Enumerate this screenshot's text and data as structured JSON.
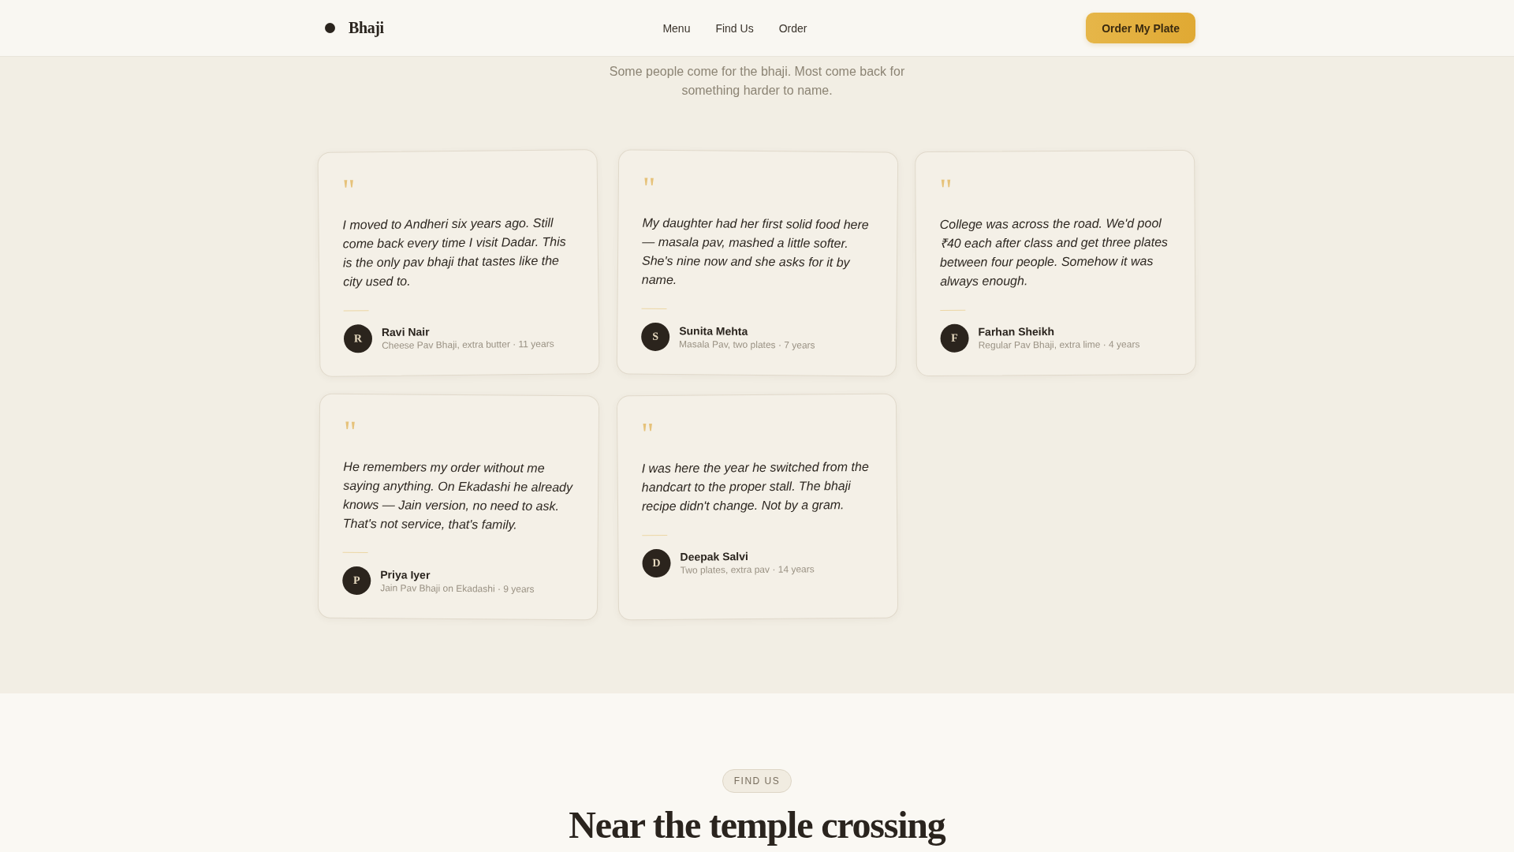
{
  "header": {
    "brand": "Bhaji",
    "nav": [
      "Menu",
      "Find Us",
      "Order"
    ],
    "cta": "Order My Plate"
  },
  "testimonials": {
    "subtitle": "Some people come for the bhaji. Most come back for something harder to name.",
    "items": [
      {
        "quote_mark": "\"",
        "quote": "I moved to Andheri six years ago. Still come back every time I visit Dadar. This is the only pav bhaji that tastes like the city used to.",
        "initial": "R",
        "name": "Ravi Nair",
        "detail": "Cheese Pav Bhaji, extra butter · 11 years"
      },
      {
        "quote_mark": "\"",
        "quote": "My daughter had her first solid food here — masala pav, mashed a little softer. She's nine now and she asks for it by name.",
        "initial": "S",
        "name": "Sunita Mehta",
        "detail": "Masala Pav, two plates · 7 years"
      },
      {
        "quote_mark": "\"",
        "quote": "College was across the road. We'd pool ₹40 each after class and get three plates between four people. Somehow it was always enough.",
        "initial": "F",
        "name": "Farhan Sheikh",
        "detail": "Regular Pav Bhaji, extra lime · 4 years"
      },
      {
        "quote_mark": "\"",
        "quote": "He remembers my order without me saying anything. On Ekadashi he already knows — Jain version, no need to ask. That's not service, that's family.",
        "initial": "P",
        "name": "Priya Iyer",
        "detail": "Jain Pav Bhaji on Ekadashi · 9 years"
      },
      {
        "quote_mark": "\"",
        "quote": "I was here the year he switched from the handcart to the proper stall. The bhaji recipe didn't change. Not by a gram.",
        "initial": "D",
        "name": "Deepak Salvi",
        "detail": "Two plates, extra pav · 14 years"
      }
    ]
  },
  "find_us": {
    "badge": "FIND US",
    "heading": "Near the temple crossing"
  }
}
